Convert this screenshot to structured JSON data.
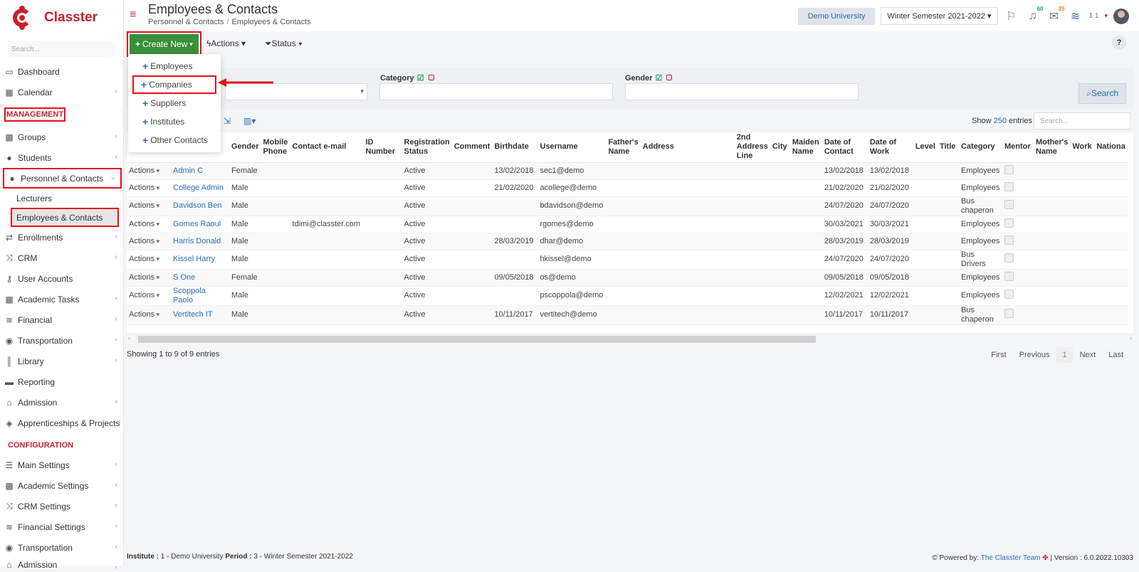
{
  "app": {
    "name": "Classter"
  },
  "sidebar": {
    "search_placeholder": "Search...",
    "items": [
      {
        "label": "Dashboard",
        "icon": "laptop-icon"
      },
      {
        "label": "Calendar",
        "icon": "calendar-icon"
      }
    ],
    "management_heading": "MANAGEMENT",
    "management_items": [
      {
        "label": "Groups"
      },
      {
        "label": "Students"
      },
      {
        "label": "Personnel & Contacts"
      }
    ],
    "personnel_sub": [
      {
        "label": "Lecturers"
      },
      {
        "label": "Employees & Contacts"
      }
    ],
    "after_items": [
      {
        "label": "Enrollments"
      },
      {
        "label": "CRM"
      },
      {
        "label": "User Accounts"
      },
      {
        "label": "Academic Tasks"
      },
      {
        "label": "Financial"
      },
      {
        "label": "Transportation"
      },
      {
        "label": "Library"
      },
      {
        "label": "Reporting"
      },
      {
        "label": "Admission"
      },
      {
        "label": "Apprenticeships & Projects"
      }
    ],
    "config_heading": "CONFIGURATION",
    "config_items": [
      {
        "label": "Main Settings"
      },
      {
        "label": "Academic Settings"
      },
      {
        "label": "CRM Settings"
      },
      {
        "label": "Financial Settings"
      },
      {
        "label": "Transportation"
      },
      {
        "label": "Admission"
      }
    ]
  },
  "header": {
    "title": "Employees & Contacts",
    "breadcrumb": [
      "Personnel & Contacts",
      "Employees & Contacts"
    ],
    "university": "Demo University",
    "semester": "Winter Semester 2021-2022",
    "notif_count": "60",
    "mail_count": "35",
    "user_num": "1 1"
  },
  "toolbar": {
    "create_label": "Create New",
    "actions_label": "Actions",
    "status_label": "Status",
    "help_label": "?"
  },
  "create_menu": [
    "Employees",
    "Companies",
    "Suppliers",
    "Institutes",
    "Other Contacts"
  ],
  "filters": {
    "category_label": "Category",
    "gender_label": "Gender",
    "search_label": "Search"
  },
  "table_ctl": {
    "show_label": "Show",
    "show_count": "250",
    "entries_label": "entries",
    "search_placeholder": "Search..."
  },
  "table": {
    "headers": [
      "",
      "",
      "Gender",
      "Mobile Phone",
      "Contact e-mail",
      "ID Number",
      "Registration Status",
      "Comment",
      "Birthdate",
      "Username",
      "Father's Name",
      "Address",
      "2nd Address Line",
      "City",
      "Maiden Name",
      "Date of Contact",
      "Date of Work",
      "Level",
      "Title",
      "Category",
      "Mentor",
      "Mother's Name",
      "Work",
      "Nationa"
    ],
    "rows": [
      {
        "actions": "Actions",
        "name": "Admin C",
        "gender": "Female",
        "mobile": "",
        "email": "",
        "id": "",
        "status": "Active",
        "comment": "",
        "birth": "13/02/2018",
        "user": "sec1@demo",
        "father": "",
        "address": "",
        "address2": "",
        "city": "",
        "maiden": "",
        "contact": "13/02/2018",
        "work": "13/02/2018",
        "level": "",
        "title": "",
        "category": "Employees",
        "mother": "",
        "workx": "",
        "nat": ""
      },
      {
        "actions": "Actions",
        "name": "College Admin",
        "gender": "Male",
        "mobile": "",
        "email": "",
        "id": "",
        "status": "Active",
        "comment": "",
        "birth": "21/02/2020",
        "user": "acollege@demo",
        "father": "",
        "address": "",
        "address2": "",
        "city": "",
        "maiden": "",
        "contact": "21/02/2020",
        "work": "21/02/2020",
        "level": "",
        "title": "",
        "category": "Employees",
        "mother": "",
        "workx": "",
        "nat": ""
      },
      {
        "actions": "Actions",
        "name": "Davidson Ben",
        "gender": "Male",
        "mobile": "",
        "email": "",
        "id": "",
        "status": "Active",
        "comment": "",
        "birth": "",
        "user": "bdavidson@demo",
        "father": "",
        "address": "",
        "address2": "",
        "city": "",
        "maiden": "",
        "contact": "24/07/2020",
        "work": "24/07/2020",
        "level": "",
        "title": "",
        "category": "Bus chaperon",
        "mother": "",
        "workx": "",
        "nat": ""
      },
      {
        "actions": "Actions",
        "name": "Gomes Raoul",
        "gender": "Male",
        "mobile": "",
        "email": "tdimi@classter.com",
        "id": "",
        "status": "Active",
        "comment": "",
        "birth": "",
        "user": "rgomes@demo",
        "father": "",
        "address": "",
        "address2": "",
        "city": "",
        "maiden": "",
        "contact": "30/03/2021",
        "work": "30/03/2021",
        "level": "",
        "title": "",
        "category": "Employees",
        "mother": "",
        "workx": "",
        "nat": ""
      },
      {
        "actions": "Actions",
        "name": "Harris Donald",
        "gender": "Male",
        "mobile": "",
        "email": "",
        "id": "",
        "status": "Active",
        "comment": "",
        "birth": "28/03/2019",
        "user": "dhar@demo",
        "father": "",
        "address": "",
        "address2": "",
        "city": "",
        "maiden": "",
        "contact": "28/03/2019",
        "work": "28/03/2019",
        "level": "",
        "title": "",
        "category": "Employees",
        "mother": "",
        "workx": "",
        "nat": ""
      },
      {
        "actions": "Actions",
        "name": "Kissel Harry",
        "gender": "Male",
        "mobile": "",
        "email": "",
        "id": "",
        "status": "Active",
        "comment": "",
        "birth": "",
        "user": "hkissel@demo",
        "father": "",
        "address": "",
        "address2": "",
        "city": "",
        "maiden": "",
        "contact": "24/07/2020",
        "work": "24/07/2020",
        "level": "",
        "title": "",
        "category": "Bus Drivers",
        "mother": "",
        "workx": "",
        "nat": ""
      },
      {
        "actions": "Actions",
        "name": "S One",
        "gender": "Female",
        "mobile": "",
        "email": "",
        "id": "",
        "status": "Active",
        "comment": "",
        "birth": "09/05/2018",
        "user": "os@demo",
        "father": "",
        "address": "",
        "address2": "",
        "city": "",
        "maiden": "",
        "contact": "09/05/2018",
        "work": "09/05/2018",
        "level": "",
        "title": "",
        "category": "Employees",
        "mother": "",
        "workx": "",
        "nat": ""
      },
      {
        "actions": "Actions",
        "name": "Scoppola Paolo",
        "gender": "Male",
        "mobile": "",
        "email": "",
        "id": "",
        "status": "Active",
        "comment": "",
        "birth": "",
        "user": "pscoppola@demo",
        "father": "",
        "address": "",
        "address2": "",
        "city": "",
        "maiden": "",
        "contact": "12/02/2021",
        "work": "12/02/2021",
        "level": "",
        "title": "",
        "category": "Employees",
        "mother": "",
        "workx": "",
        "nat": ""
      },
      {
        "actions": "Actions",
        "name": "Vertitech IT",
        "gender": "Male",
        "mobile": "",
        "email": "",
        "id": "",
        "status": "Active",
        "comment": "",
        "birth": "10/11/2017",
        "user": "vertitech@demo",
        "father": "",
        "address": "",
        "address2": "",
        "city": "",
        "maiden": "",
        "contact": "10/11/2017",
        "work": "10/11/2017",
        "level": "",
        "title": "",
        "category": "Bus chaperon",
        "mother": "",
        "workx": "",
        "nat": ""
      }
    ]
  },
  "pagination": {
    "showing": "Showing 1 to 9 of 9 entries",
    "first": "First",
    "previous": "Previous",
    "current": "1",
    "next": "Next",
    "last": "Last"
  },
  "footer": {
    "institute_label": "Institute :",
    "institute_value": "1 - Demo University",
    "period_label": "Period :",
    "period_value": "3 - Winter Semester 2021-2022",
    "powered": "Powered by:",
    "team": "The Classter Team",
    "version": "| Version : 6.0.2022.10303"
  },
  "colors": {
    "brand": "#c8202f",
    "link": "#2a6db5",
    "create": "#3a8f3a",
    "highlight": "#e3101a"
  }
}
